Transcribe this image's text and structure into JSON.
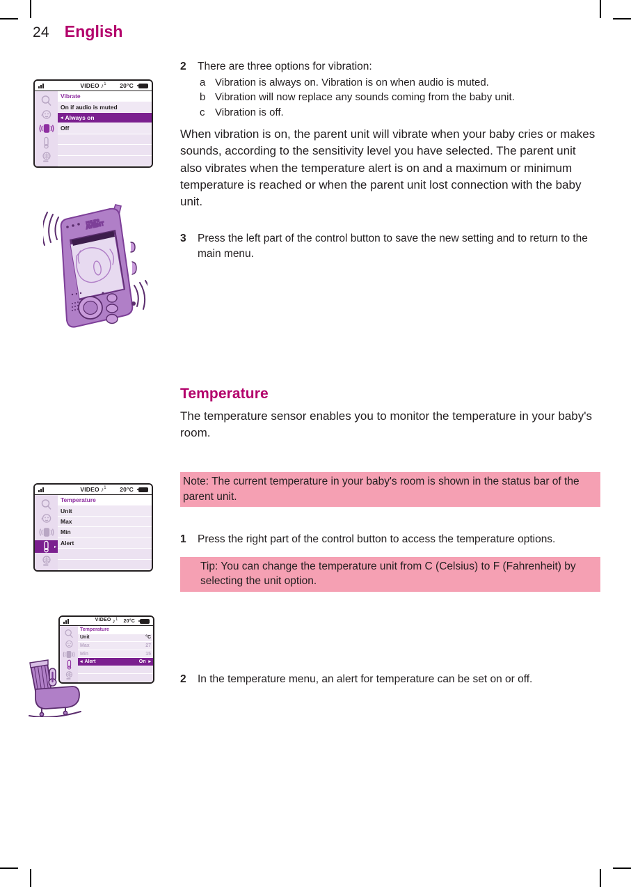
{
  "header": {
    "page_number": "24",
    "language": "English"
  },
  "colors": {
    "brand_magenta": "#b3006b",
    "callout_pink": "#f5a0b3",
    "lcd_purple": "#7b1f8f",
    "lcd_light": "#ece2f1",
    "lcd_rail": "#e9dcef",
    "text": "#231f20"
  },
  "content": {
    "step2_vibration": {
      "number": "2",
      "text": "There are three options for vibration:",
      "options": [
        {
          "marker": "a",
          "text": "Vibration is always on. Vibration is on when audio is muted."
        },
        {
          "marker": "b",
          "text": "Vibration will now replace any sounds coming from the baby unit."
        },
        {
          "marker": "c",
          "text": "Vibration is off."
        }
      ]
    },
    "vibration_paragraph": "When vibration is on, the parent unit will vibrate when your baby cries or makes sounds, according to the sensitivity level you have selected. The parent unit also vibrates when the temperature alert is on and a maximum or minimum temperature is reached or when the parent unit lost connection with the baby unit.",
    "step3_save": {
      "number": "3",
      "text": "Press the left part of the control button to save the new setting and to return to the main menu."
    },
    "temperature_section": {
      "title": "Temperature",
      "intro": "The temperature sensor enables you to monitor the temperature in your baby's room.",
      "note": "Note: The current temperature in your baby's room is shown in the status bar of the parent unit.",
      "step1": {
        "number": "1",
        "text": "Press the right part of the control button to access the temperature options."
      },
      "tip": "Tip: You can change the temperature unit from C (Celsius) to F (Fahrenheit) by selecting the unit option.",
      "step2": {
        "number": "2",
        "text": "In the temperature menu, an alert for temperature can be set on or off."
      }
    }
  },
  "lcd_screens": {
    "vibrate_menu": {
      "status_bar": {
        "signal_icon": "signal-bars-icon",
        "mode_label": "VIDEO",
        "sound_icon": "music-note-icon",
        "sound_superscript": "1",
        "temperature": "20°C",
        "battery_icon": "battery-icon"
      },
      "rail_icons": [
        {
          "name": "magnifier-icon",
          "state": "inactive"
        },
        {
          "name": "baby-face-icon",
          "state": "inactive"
        },
        {
          "name": "vibrate-icon",
          "state": "active"
        },
        {
          "name": "thermometer-icon",
          "state": "inactive"
        },
        {
          "name": "night-light-icon",
          "state": "inactive"
        }
      ],
      "rows": [
        {
          "label": "Vibrate",
          "style": "header",
          "value": ""
        },
        {
          "label": "On if audio is muted",
          "style": "plain",
          "value": ""
        },
        {
          "label": "Always on",
          "style": "sel",
          "value": "",
          "arrow_left": "◂"
        },
        {
          "label": "Off",
          "style": "plain",
          "value": ""
        },
        {
          "label": "",
          "style": "empty",
          "value": ""
        },
        {
          "label": "",
          "style": "empty",
          "value": ""
        },
        {
          "label": "",
          "style": "empty",
          "value": ""
        }
      ]
    },
    "temperature_menu": {
      "status_bar": {
        "signal_icon": "signal-bars-icon",
        "mode_label": "VIDEO",
        "sound_icon": "music-note-icon",
        "sound_superscript": "1",
        "temperature": "20°C",
        "battery_icon": "battery-icon"
      },
      "rail_icons": [
        {
          "name": "magnifier-icon",
          "state": "inactive"
        },
        {
          "name": "baby-face-icon",
          "state": "inactive"
        },
        {
          "name": "vibrate-icon",
          "state": "inactive"
        },
        {
          "name": "thermometer-icon",
          "state": "selected"
        },
        {
          "name": "night-light-icon",
          "state": "inactive"
        }
      ],
      "rows": [
        {
          "label": "Temperature",
          "style": "header",
          "value": ""
        },
        {
          "label": "Unit",
          "style": "plain",
          "value": ""
        },
        {
          "label": "Max",
          "style": "plain",
          "value": ""
        },
        {
          "label": "Min",
          "style": "plain",
          "value": ""
        },
        {
          "label": "Alert",
          "style": "plain",
          "value": ""
        },
        {
          "label": "",
          "style": "empty",
          "value": ""
        },
        {
          "label": "",
          "style": "empty",
          "value": ""
        }
      ]
    },
    "temperature_values": {
      "status_bar": {
        "signal_icon": "signal-bars-icon",
        "mode_label": "VIDEO",
        "sound_icon": "music-note-icon",
        "sound_superscript": "1",
        "temperature": "20°C",
        "battery_icon": "battery-icon"
      },
      "rail_icons": [
        {
          "name": "magnifier-icon",
          "state": "inactive"
        },
        {
          "name": "baby-face-icon",
          "state": "inactive"
        },
        {
          "name": "vibrate-icon",
          "state": "inactive"
        },
        {
          "name": "thermometer-icon",
          "state": "active"
        },
        {
          "name": "night-light-icon",
          "state": "inactive"
        }
      ],
      "rows": [
        {
          "label": "Temperature",
          "style": "header",
          "value": ""
        },
        {
          "label": "Unit",
          "style": "plain",
          "value": "°C"
        },
        {
          "label": "Max",
          "style": "dim",
          "value": "27"
        },
        {
          "label": "Min",
          "style": "dim",
          "value": "15"
        },
        {
          "label": "Alert",
          "style": "sel",
          "value": "On",
          "arrow_left": "◂",
          "arrow_right": "▸"
        },
        {
          "label": "",
          "style": "empty",
          "value": ""
        },
        {
          "label": "",
          "style": "empty",
          "value": ""
        }
      ]
    }
  },
  "illustrations": {
    "parent_unit": {
      "name": "parent-unit-vibrating-illustration",
      "brand": "PHILIPS",
      "sub_brand": "AVENT"
    },
    "chair": {
      "name": "nursery-chair-thermometer-illustration"
    }
  }
}
